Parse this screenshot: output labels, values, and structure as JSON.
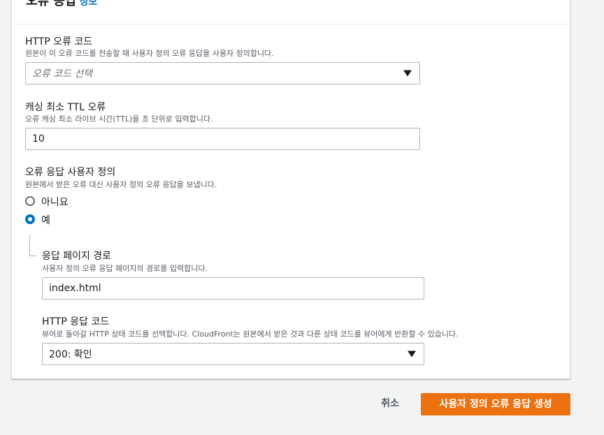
{
  "panel": {
    "title": "오류 응답",
    "info_link": "정보"
  },
  "error_code": {
    "label": "HTTP 오류 코드",
    "description": "원본이 이 오류 코드를 전송할 때 사용자 정의 오류 응답을 사용자 정의합니다.",
    "placeholder": "오류 코드 선택"
  },
  "ttl": {
    "label": "캐싱 최소 TTL 오류",
    "description": "오류 캐싱 최소 라이브 시간(TTL)을 초 단위로 입력합니다.",
    "value": "10"
  },
  "customize": {
    "label": "오류 응답 사용자 정의",
    "description": "원본에서 받은 오류 대신 사용자 정의 오류 응답을 보냅니다.",
    "options": [
      {
        "label": "아니요",
        "selected": false
      },
      {
        "label": "예",
        "selected": true
      }
    ]
  },
  "response_path": {
    "label": "응답 페이지 경로",
    "description": "사용자 정의 오류 응답 페이지의 경로를 입력합니다.",
    "value": "index.html"
  },
  "response_code": {
    "label": "HTTP 응답 코드",
    "description": "뷰어로 돌아갈 HTTP 상태 코드를 선택합니다. CloudFront는 원본에서 받은 것과 다른 상태 코드를 뷰어에게 반환할 수 있습니다.",
    "value": "200: 확인"
  },
  "actions": {
    "cancel_label": "취소",
    "create_label": "사용자 정의 오류 응답 생성"
  },
  "colors": {
    "primary": "#ec7211",
    "link": "#0073bb",
    "radio_checked": "#0073bb",
    "background": "#f2f3f3"
  }
}
